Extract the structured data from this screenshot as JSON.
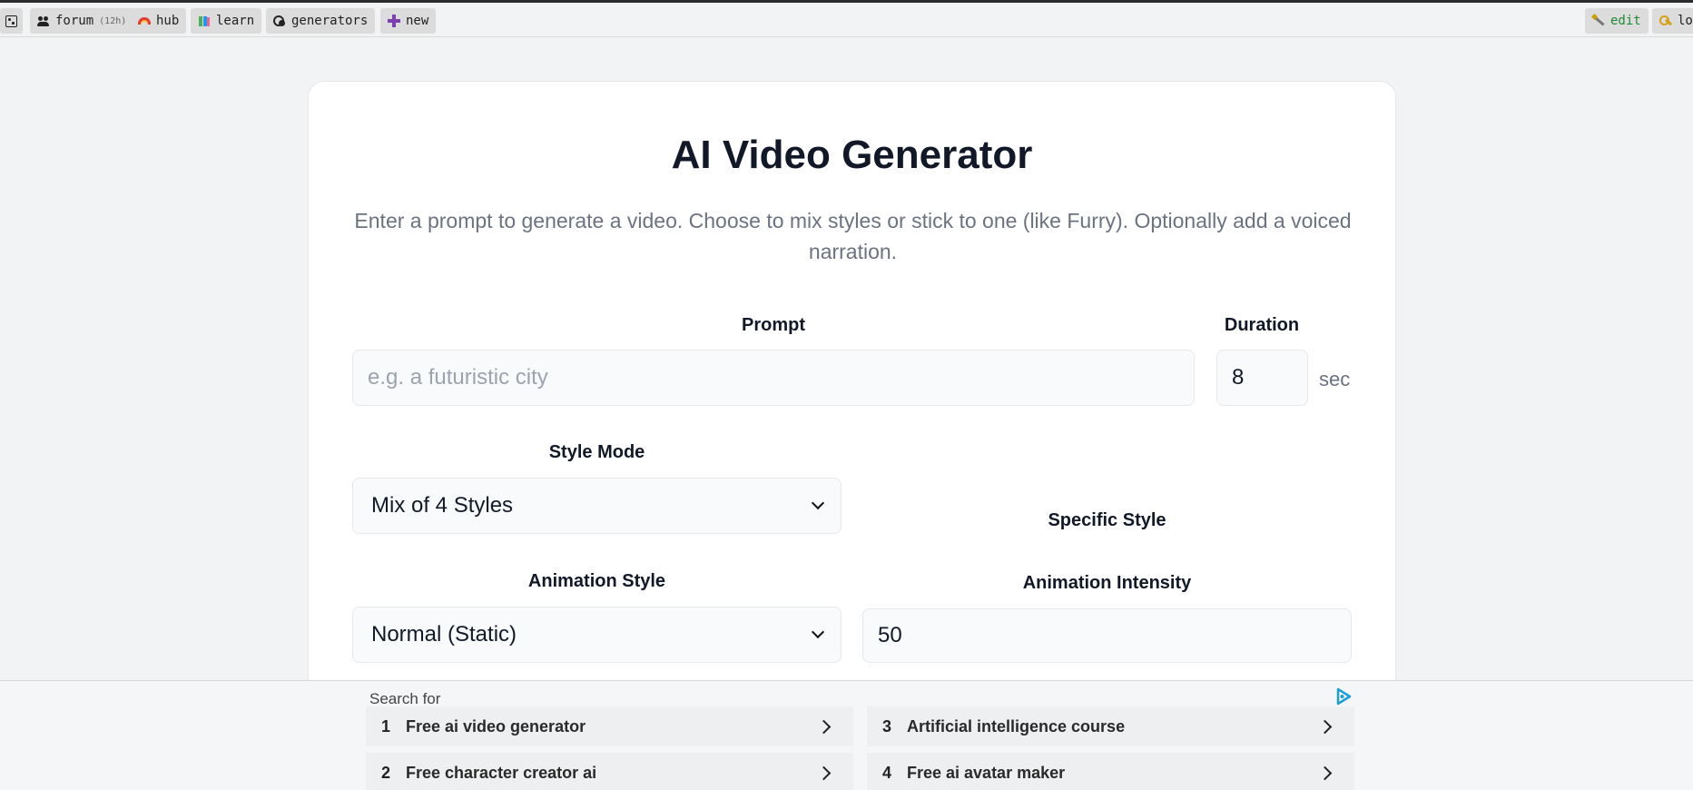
{
  "topbar": {
    "left": [
      {
        "icon": "dice-icon",
        "label": ""
      },
      {
        "icon": "people-icon",
        "label": "forum",
        "sub": "(12h)"
      },
      {
        "icon": "rainbow-icon",
        "label": "hub"
      },
      {
        "icon": "books-icon",
        "label": "learn"
      },
      {
        "icon": "gears-icon",
        "label": "generators"
      },
      {
        "icon": "plus-icon",
        "label": "new"
      }
    ],
    "right": [
      {
        "icon": "magic-wand-icon",
        "label": "edit"
      },
      {
        "icon": "key-icon",
        "label": "lo"
      }
    ]
  },
  "main": {
    "title": "AI Video Generator",
    "subtitle": "Enter a prompt to generate a video. Choose to mix styles or stick to one (like Furry). Optionally add a voiced narration.",
    "prompt": {
      "label": "Prompt",
      "placeholder": "e.g. a futuristic city",
      "value": ""
    },
    "duration": {
      "label": "Duration",
      "value": "8",
      "unit": "sec"
    },
    "style_mode": {
      "label": "Style Mode",
      "selected": "Mix of 4 Styles"
    },
    "specific_style": {
      "label": "Specific Style"
    },
    "animation_style": {
      "label": "Animation Style",
      "selected": "Normal (Static)"
    },
    "animation_intensity": {
      "label": "Animation Intensity",
      "value": "50"
    }
  },
  "ad": {
    "heading": "Search for",
    "logo_icon": "ad-choices-icon",
    "items": [
      {
        "num": "1",
        "text": "Free ai video generator"
      },
      {
        "num": "2",
        "text": "Free character creator ai"
      },
      {
        "num": "3",
        "text": "Artificial intelligence course"
      },
      {
        "num": "4",
        "text": "Free ai avatar maker"
      }
    ]
  }
}
